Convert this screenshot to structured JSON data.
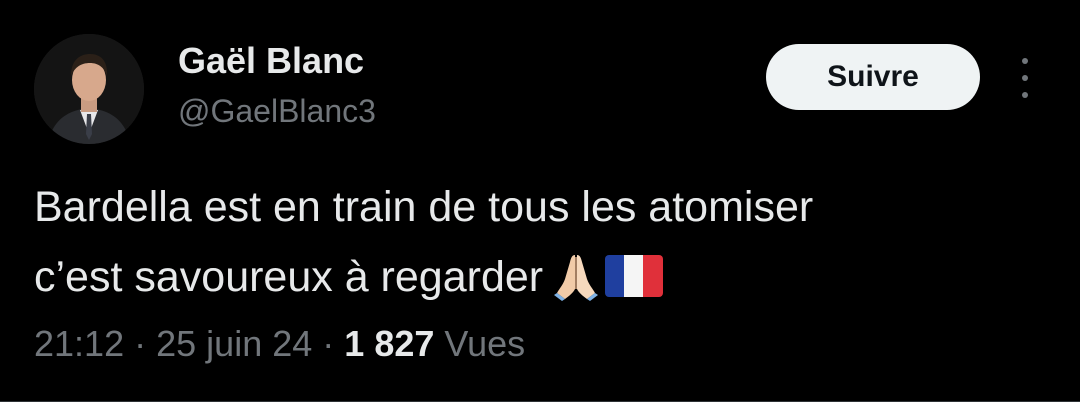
{
  "author": {
    "name": "Gaël Blanc",
    "handle": "@GaelBlanc3",
    "avatar_icon": "person-in-suit-avatar"
  },
  "follow_button": {
    "label": "Suivre"
  },
  "more_button": {
    "icon": "vertical-dots-icon"
  },
  "tweet": {
    "line1": "Bardella est en train de tous les atomiser",
    "line2": "c’est savoureux à regarder",
    "emojis": [
      "folded-hands-emoji",
      "france-flag-emoji"
    ]
  },
  "meta": {
    "time": "21:12",
    "separator": "·",
    "date": "25 juin 24",
    "views_count": "1 827",
    "views_label": "Vues"
  },
  "colors": {
    "background": "#000000",
    "text_primary": "#e7e9ea",
    "text_secondary": "#71767b",
    "button_bg": "#eff3f4",
    "button_text": "#0f1419"
  }
}
